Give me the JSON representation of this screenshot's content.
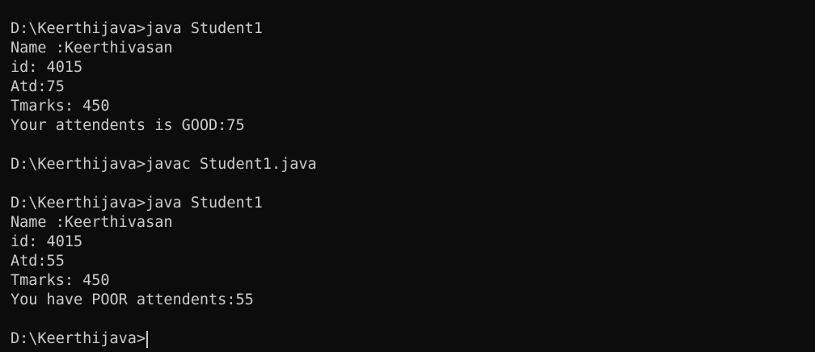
{
  "terminal": {
    "lines": [
      "D:\\Keerthijava>java Student1",
      "Name :Keerthivasan",
      "id: 4015",
      "Atd:75",
      "Tmarks: 450",
      "Your attendents is GOOD:75",
      "",
      "D:\\Keerthijava>javac Student1.java",
      "",
      "D:\\Keerthijava>java Student1",
      "Name :Keerthivasan",
      "id: 4015",
      "Atd:55",
      "Tmarks: 450",
      "You have POOR attendents:55",
      ""
    ],
    "prompt": "D:\\Keerthijava>"
  },
  "colors": {
    "background": "#0c0c0c",
    "foreground": "#cccccc"
  }
}
